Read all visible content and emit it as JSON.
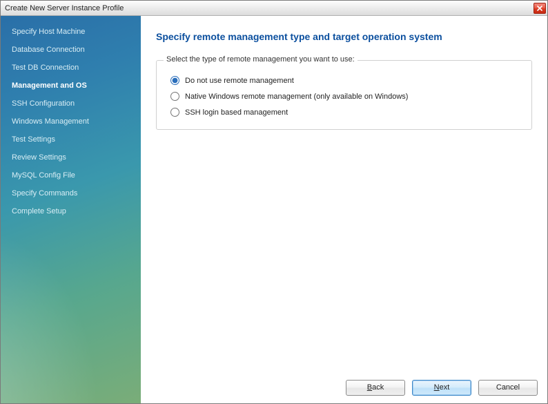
{
  "window": {
    "title": "Create New Server Instance Profile"
  },
  "sidebar": {
    "items": [
      {
        "label": "Specify Host Machine",
        "active": false
      },
      {
        "label": "Database Connection",
        "active": false
      },
      {
        "label": "Test DB Connection",
        "active": false
      },
      {
        "label": "Management and OS",
        "active": true
      },
      {
        "label": "SSH Configuration",
        "active": false
      },
      {
        "label": "Windows Management",
        "active": false
      },
      {
        "label": "Test Settings",
        "active": false
      },
      {
        "label": "Review Settings",
        "active": false
      },
      {
        "label": "MySQL Config File",
        "active": false
      },
      {
        "label": "Specify Commands",
        "active": false
      },
      {
        "label": "Complete Setup",
        "active": false
      }
    ]
  },
  "page": {
    "title": "Specify remote management type and target operation system",
    "group_legend": "Select the type of remote management you want to use:",
    "options": [
      {
        "label": "Do not use remote management",
        "selected": true
      },
      {
        "label": "Native Windows remote management (only available on Windows)",
        "selected": false
      },
      {
        "label": "SSH login based management",
        "selected": false
      }
    ]
  },
  "footer": {
    "back": "Back",
    "next": "Next",
    "cancel": "Cancel"
  }
}
